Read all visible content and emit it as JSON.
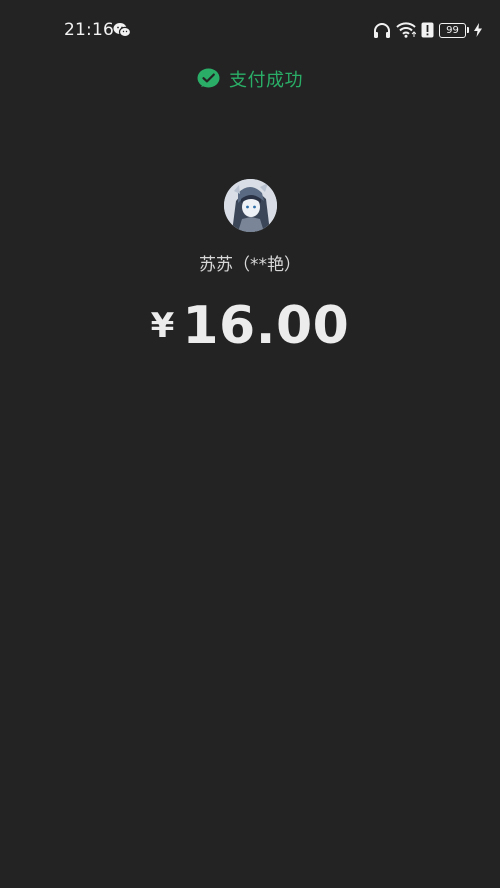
{
  "status_bar": {
    "time": "21:16",
    "battery_level": "99",
    "icons": [
      "wechat-icon",
      "headphones-icon",
      "wifi-icon",
      "alert-icon",
      "battery-icon",
      "charging-icon"
    ]
  },
  "result": {
    "title": "支付成功",
    "icon": "check-circle-icon",
    "accent_color": "#2aae67"
  },
  "payee": {
    "name": "苏苏（**艳）"
  },
  "amount": {
    "currency": "¥",
    "value": "16.00"
  },
  "colors": {
    "background": "#232323",
    "text": "#ececec"
  }
}
